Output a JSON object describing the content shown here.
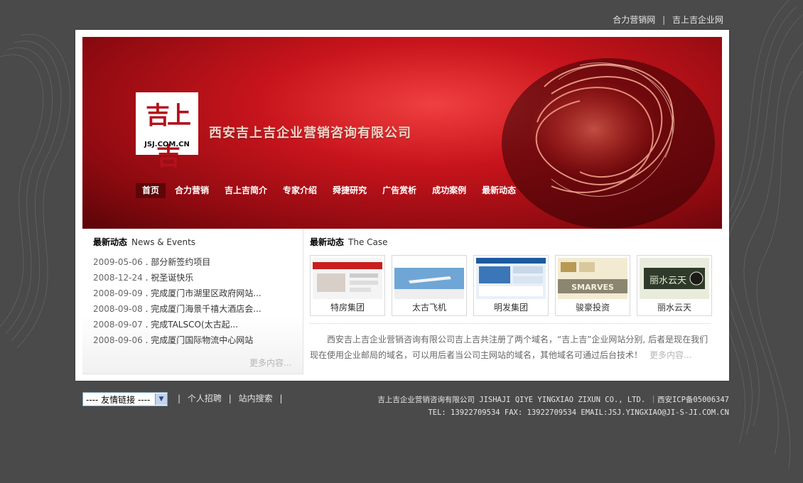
{
  "top_links": {
    "link1": "合力营销网",
    "separator": "|",
    "link2": "吉上吉企业网"
  },
  "logo": {
    "glyph": "吉上吉",
    "domain": "JSJ.COM.CN"
  },
  "company_title": "西安吉上吉企业营销咨询有限公司",
  "nav": [
    {
      "label": "首页"
    },
    {
      "label": "合力营销"
    },
    {
      "label": "吉上吉简介"
    },
    {
      "label": "专家介绍"
    },
    {
      "label": "舜捷研究"
    },
    {
      "label": "广告赏析"
    },
    {
      "label": "成功案例"
    },
    {
      "label": "最新动态"
    }
  ],
  "news": {
    "title": "最新动态",
    "subtitle": "News & Events",
    "items": [
      {
        "date": "2009-05-06",
        "text": "部分新签约项目"
      },
      {
        "date": "2008-12-24",
        "text": "祝圣诞快乐"
      },
      {
        "date": "2008-09-09",
        "text": "完成厦门市湖里区政府网站..."
      },
      {
        "date": "2008-09-08",
        "text": "完成厦门海景千禧大酒店会..."
      },
      {
        "date": "2008-09-07",
        "text": "完成TALSCO(太古起..."
      },
      {
        "date": "2008-09-06",
        "text": "完成厦门国际物流中心网站"
      }
    ],
    "more": "更多内容..."
  },
  "cases": {
    "title": "最新动态",
    "subtitle": "The Case",
    "items": [
      {
        "caption": "特房集团"
      },
      {
        "caption": "太古飞机"
      },
      {
        "caption": "明发集团"
      },
      {
        "caption": "骏豪投资",
        "thumb_text": "SMARVES"
      },
      {
        "caption": "丽水云天",
        "thumb_text": "丽水云天"
      }
    ]
  },
  "about": {
    "text": "西安吉上吉企业营销咨询有限公司吉上吉共注册了两个域名，“吉上吉”企业网站分别, 后者是现在我们现在使用企业邮局的域名，可以用后者当公司主网站的域名，其他域名可通过后台技术！",
    "more": "更多内容..."
  },
  "footer": {
    "select_value": "---- 友情链接 ----",
    "sep": "|",
    "link1": "个人招聘",
    "link2": "站内搜索",
    "info_line1": "吉上吉企业营销咨询有限公司 JISHAJI QIYE YINGXIAO ZIXUN CO., LTD. ｜西安ICP备05006347",
    "info_line2": "TEL: 13922709534  FAX: 13922709534    EMAIL:JSJ.YINGXIAO@JI-S-JI.COM.CN"
  },
  "colors": {
    "banner_red": "#c8141c",
    "nav_active": "#5c0608",
    "page_bg": "#4a4a4a"
  }
}
